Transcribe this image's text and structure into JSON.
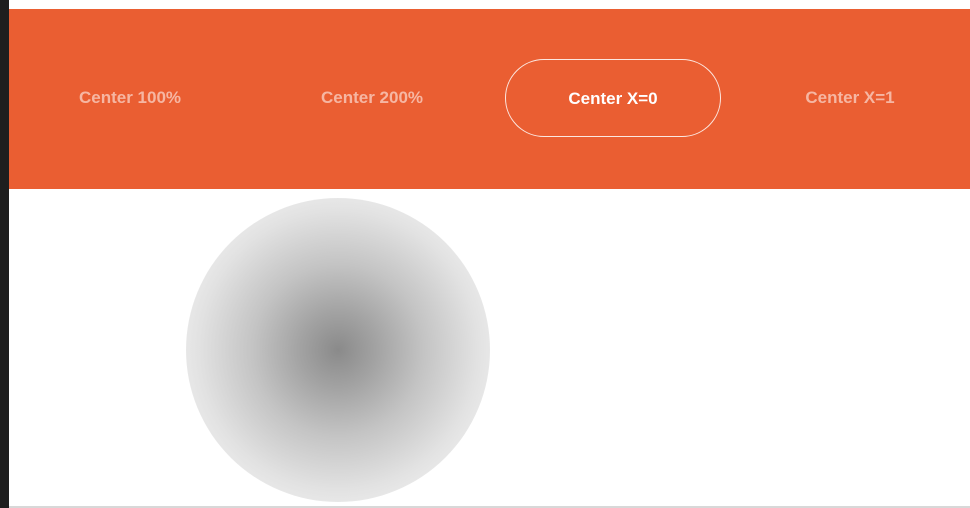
{
  "colors": {
    "accent": "#ea5e32",
    "tab_inactive_text": "rgba(255,255,255,0.55)",
    "tab_active_text": "#ffffff"
  },
  "toolbar": {
    "tabs": [
      {
        "label": "Center 100%",
        "active": false
      },
      {
        "label": "Center 200%",
        "active": false
      },
      {
        "label": "Center X=0",
        "active": true
      },
      {
        "label": "Center X=1",
        "active": false
      }
    ]
  },
  "preview": {
    "shape": "radial-gradient-circle",
    "gradient_from": "#8a8a8a",
    "gradient_to": "#ffffff"
  }
}
